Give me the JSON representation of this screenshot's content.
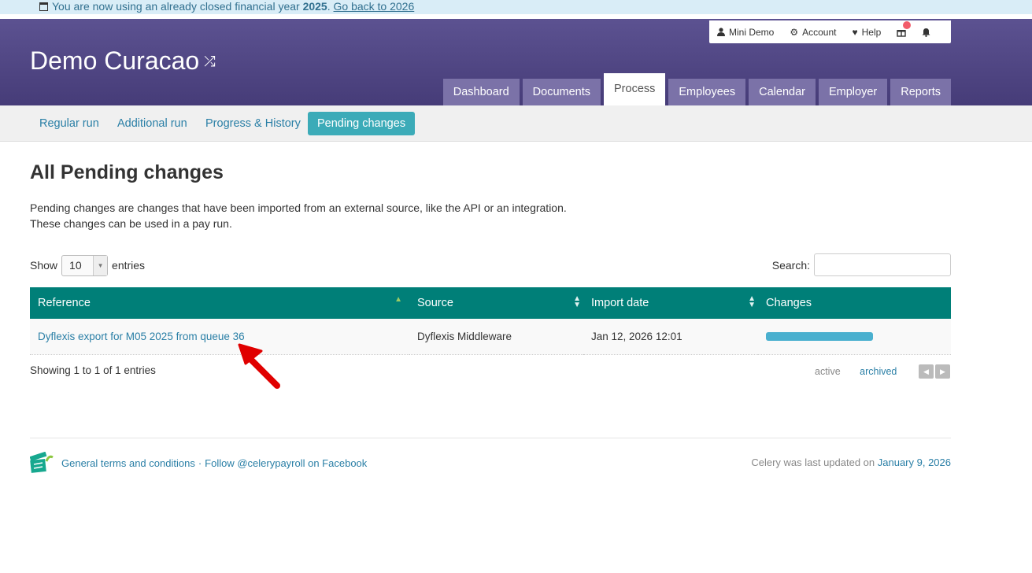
{
  "banner": {
    "text_before": "You are now using an already closed financial year",
    "year": "2025",
    "period": ".",
    "link": "Go back to 2026"
  },
  "header": {
    "company": "Demo Curacao",
    "topbar": {
      "user": "Mini Demo",
      "account": "Account",
      "help": "Help"
    },
    "nav": [
      "Dashboard",
      "Documents",
      "Process",
      "Employees",
      "Calendar",
      "Employer",
      "Reports"
    ],
    "active_nav": "Process"
  },
  "subnav": {
    "items": [
      "Regular run",
      "Additional run",
      "Progress & History",
      "Pending changes"
    ],
    "active": "Pending changes"
  },
  "page": {
    "title": "All Pending changes",
    "desc_line1": "Pending changes are changes that have been imported from an external source, like the API or an integration.",
    "desc_line2": "These changes can be used in a pay run."
  },
  "table_controls": {
    "show_label": "Show",
    "entries_value": "10",
    "entries_label": "entries",
    "search_label": "Search:"
  },
  "table": {
    "columns": [
      "Reference",
      "Source",
      "Import date",
      "Changes"
    ],
    "rows": [
      {
        "reference": "Dyflexis export for M05 2025 from queue 36",
        "source": "Dyflexis Middleware",
        "import_date": "Jan 12, 2026 12:01"
      }
    ]
  },
  "table_footer": {
    "info": "Showing 1 to 1 of 1 entries",
    "filter_active": "active",
    "filter_archived": "archived"
  },
  "footer": {
    "terms": "General terms and conditions",
    "separator": "·",
    "follow": "Follow @celerypayroll on Facebook",
    "updated_prefix": "Celery was last updated on",
    "updated_date": "January 9, 2026"
  },
  "colors": {
    "header": "#4f4585",
    "table_header": "#007f78",
    "accent": "#3cabb8",
    "link": "#2a7fa6",
    "annotation_arrow": "#e00000"
  }
}
